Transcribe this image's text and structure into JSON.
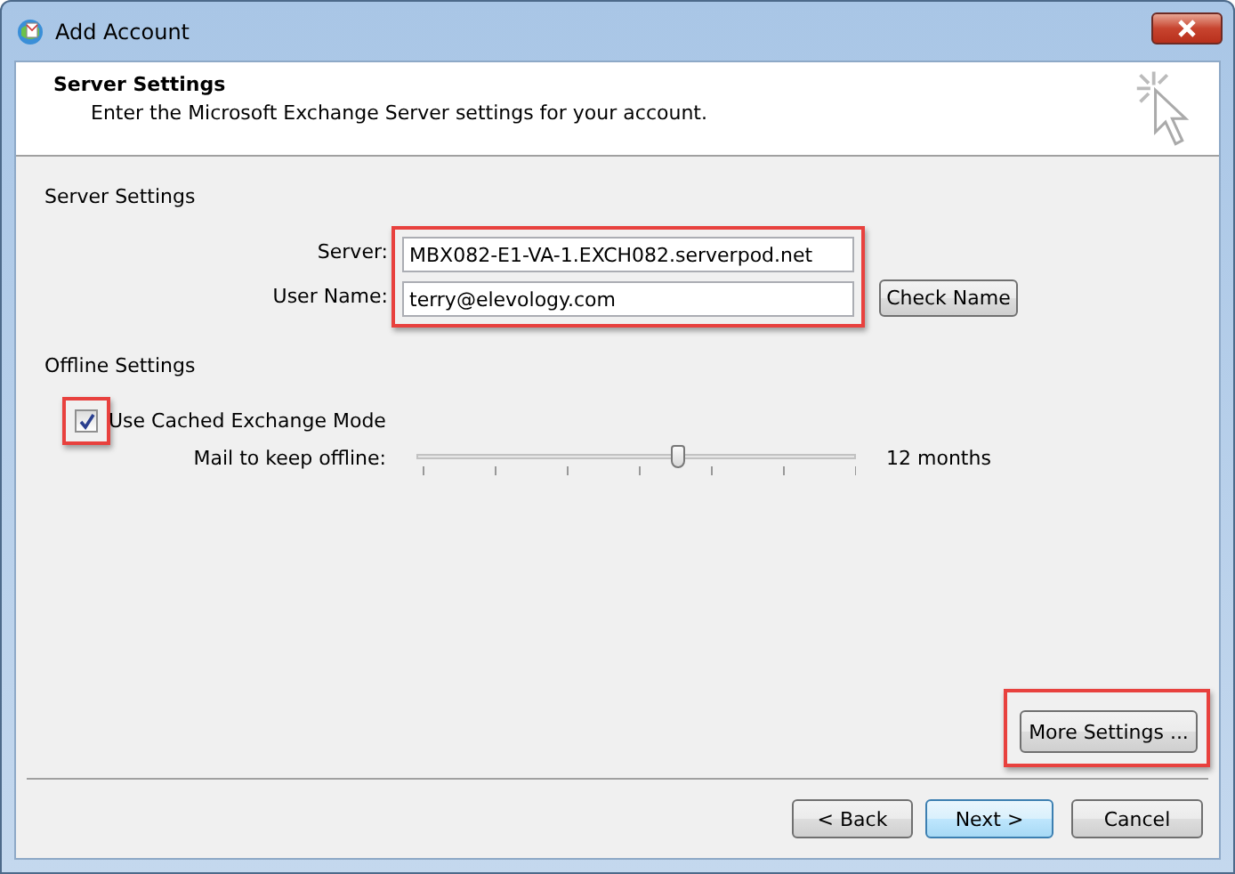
{
  "window": {
    "title": "Add Account"
  },
  "header": {
    "title": "Server Settings",
    "description": "Enter the Microsoft Exchange Server settings for your account."
  },
  "server_settings": {
    "heading": "Server Settings",
    "highlighted": true,
    "fields": [
      {
        "label": "Server:",
        "value": "MBX082-E1-VA-1.EXCH082.serverpod.net"
      },
      {
        "label": "User Name:",
        "value": "terry@elevology.com"
      }
    ],
    "check_button": "Check Name"
  },
  "offline_settings": {
    "heading": "Offline Settings",
    "cached_mode": {
      "label": "Use Cached Exchange Mode",
      "checked": true,
      "highlighted": true
    },
    "slider": {
      "label": "Mail to keep offline:",
      "level": 0.6,
      "reading": "12 months"
    }
  },
  "more_settings": {
    "label": "More Settings ...",
    "highlighted": true
  },
  "buttons": [
    {
      "label": "< Back",
      "default": false
    },
    {
      "label": "Next >",
      "default": true
    },
    {
      "label": "Cancel",
      "default": false
    }
  ]
}
